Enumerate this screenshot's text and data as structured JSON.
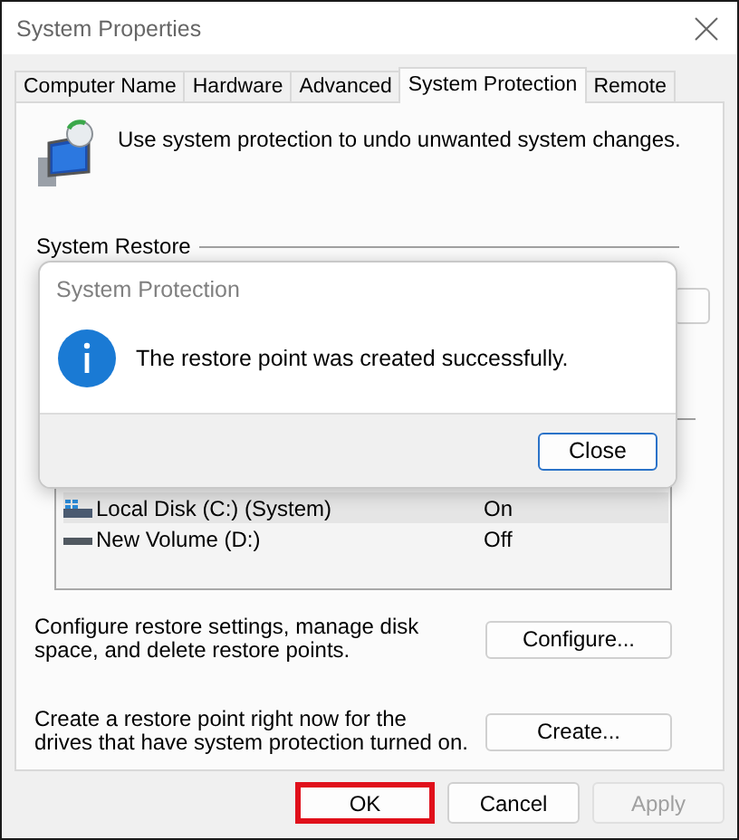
{
  "window": {
    "title": "System Properties"
  },
  "tabs": [
    {
      "label": "Computer Name",
      "selected": false
    },
    {
      "label": "Hardware",
      "selected": false
    },
    {
      "label": "Advanced",
      "selected": false
    },
    {
      "label": "System Protection",
      "selected": true
    },
    {
      "label": "Remote",
      "selected": false
    }
  ],
  "intro": "Use system protection to undo unwanted system changes.",
  "system_restore": {
    "heading": "System Restore"
  },
  "drives": [
    {
      "name": "Local Disk (C:) (System)",
      "protection": "On",
      "kind": "system",
      "selected": true
    },
    {
      "name": "New Volume (D:)",
      "protection": "Off",
      "kind": "volume",
      "selected": false
    }
  ],
  "configure": {
    "description": "Configure restore settings, manage disk space, and delete restore points.",
    "button": "Configure..."
  },
  "create": {
    "description": "Create a restore point right now for the drives that have system protection turned on.",
    "button": "Create..."
  },
  "buttons": [
    {
      "label": "OK",
      "highlighted": true,
      "disabled": false
    },
    {
      "label": "Cancel",
      "highlighted": false,
      "disabled": false
    },
    {
      "label": "Apply",
      "highlighted": false,
      "disabled": true
    }
  ],
  "dialog": {
    "title": "System Protection",
    "message": "The restore point was created successfully.",
    "button": "Close"
  }
}
